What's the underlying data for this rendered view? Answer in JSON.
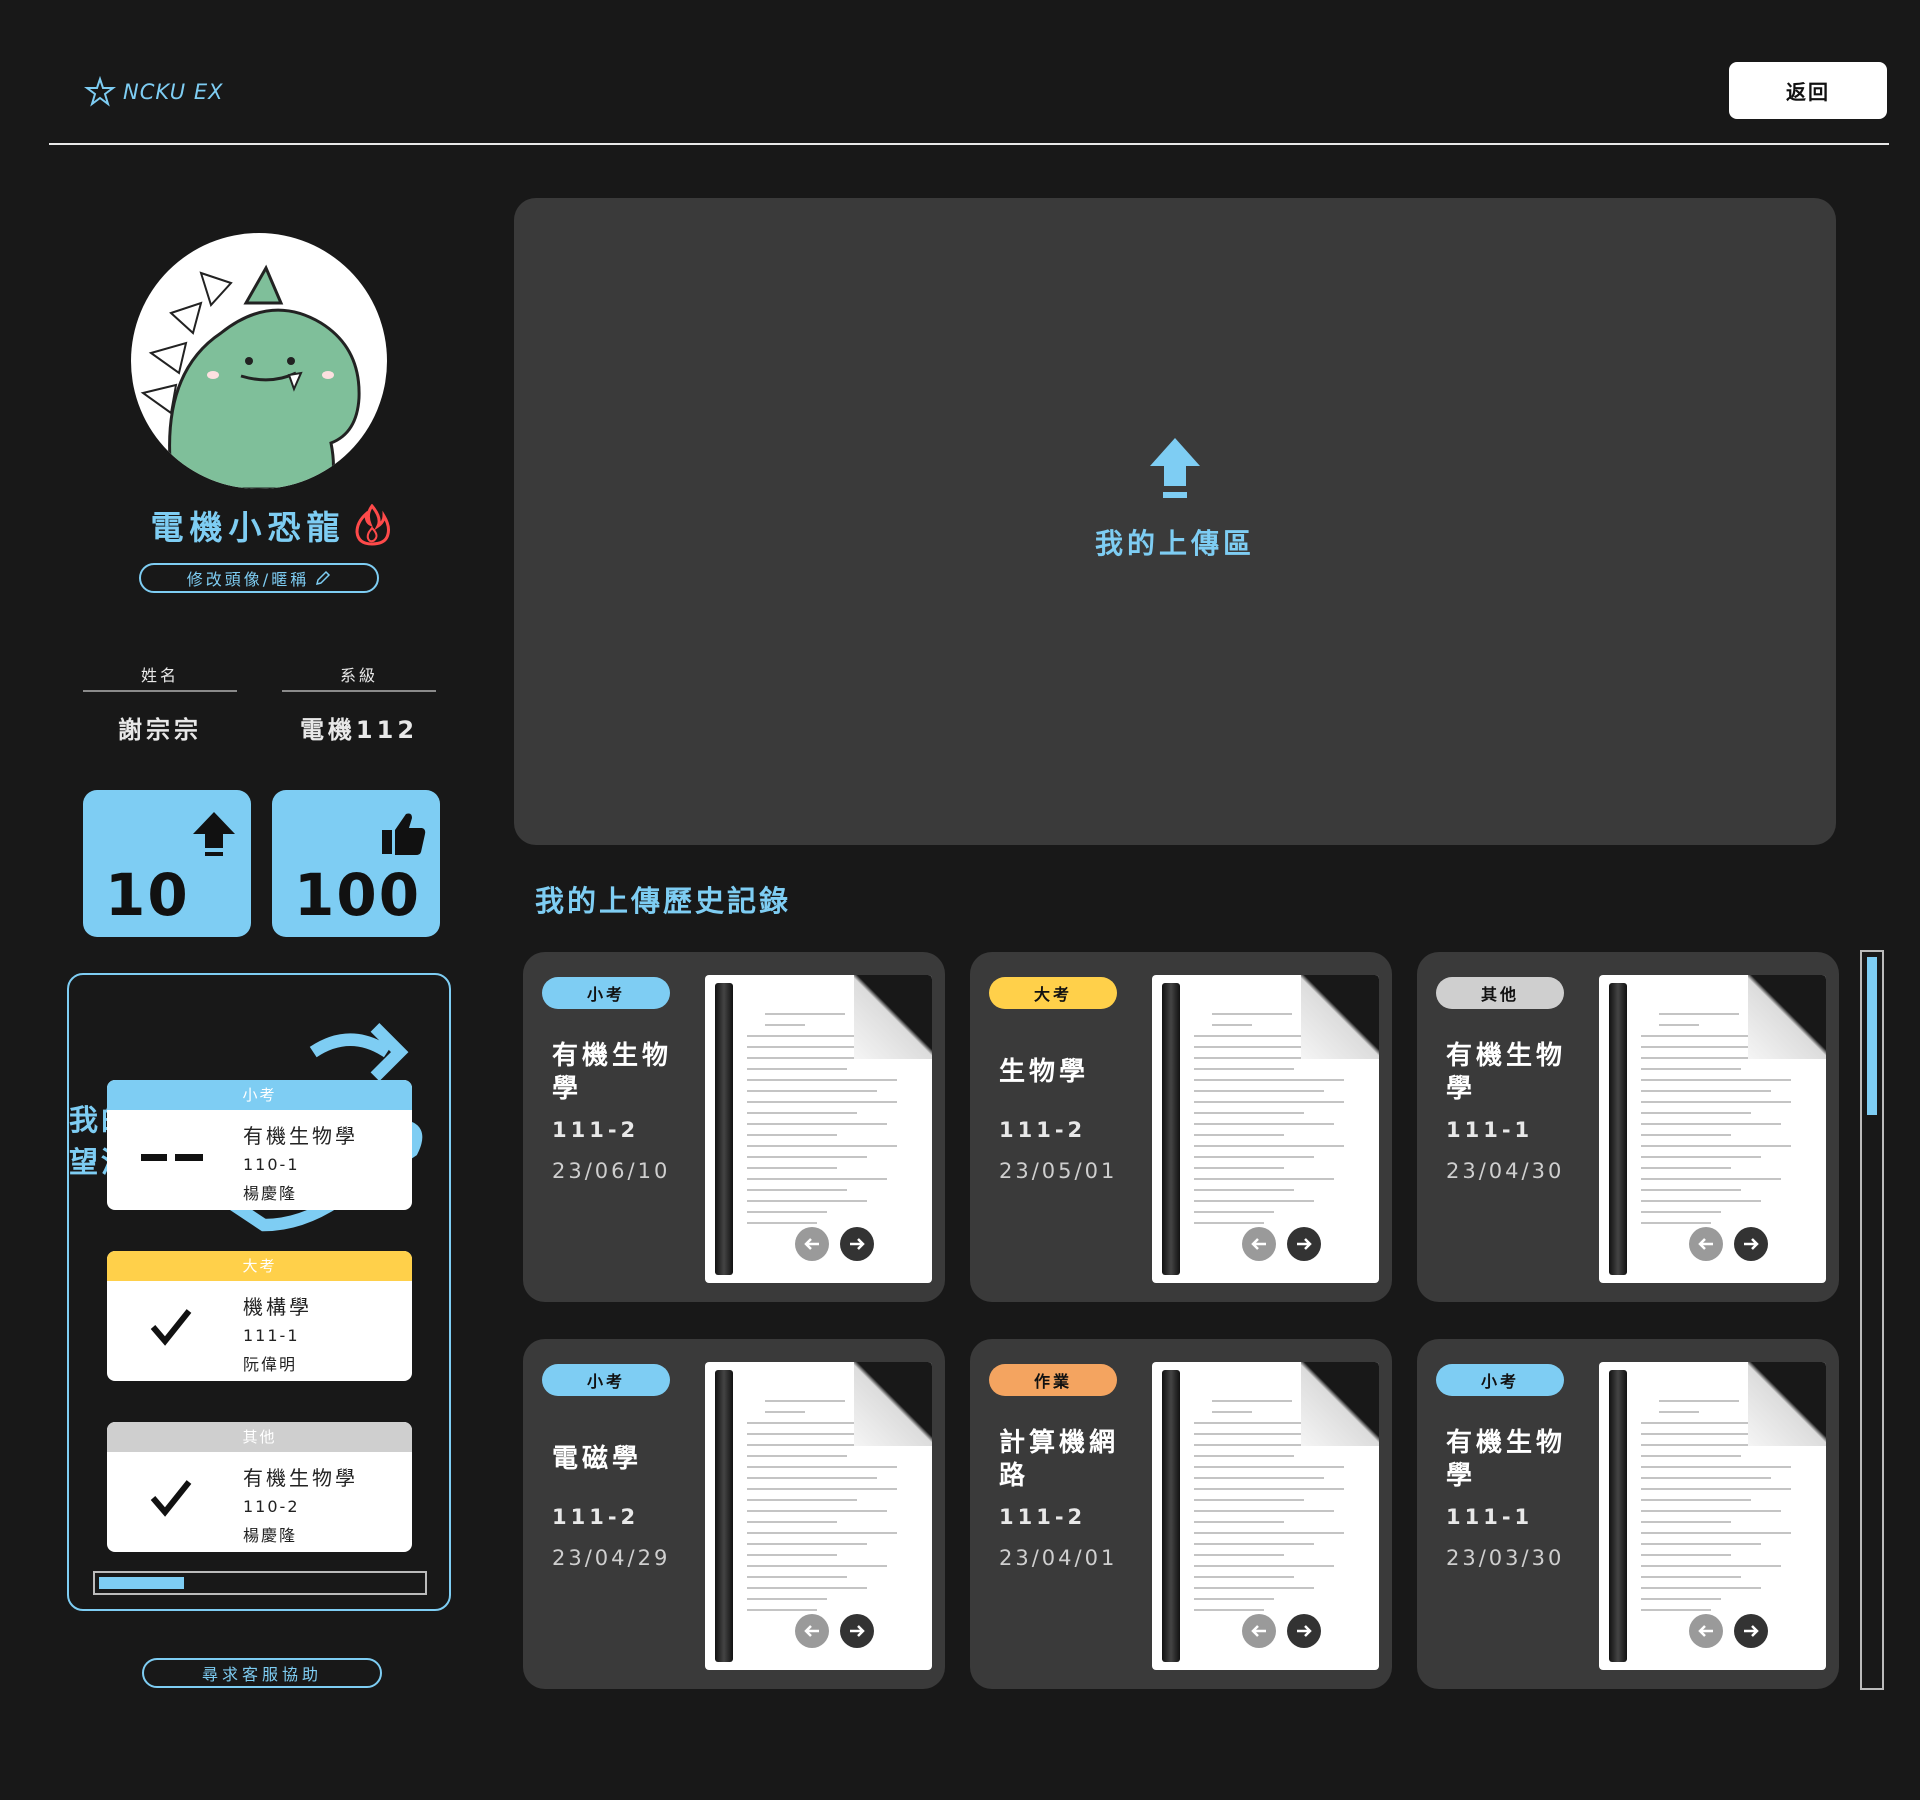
{
  "header": {
    "logo_text": "NCKU EX",
    "back_label": "返回"
  },
  "profile": {
    "nickname": "電機小恐龍",
    "edit_label": "修改頭像/暱稱",
    "name_label": "姓名",
    "name_value": "謝宗宗",
    "dept_label": "系級",
    "dept_value": "電機112",
    "uploads_count": "10",
    "likes_count": "100"
  },
  "wishlist": {
    "title": "我的願望清單",
    "items": [
      {
        "tag": "小考",
        "tag_color": "#7ecdf3",
        "status": "pending",
        "course": "有機生物學",
        "semester": "110-1",
        "teacher": "楊慶隆"
      },
      {
        "tag": "大考",
        "tag_color": "#ffd04a",
        "status": "done",
        "course": "機構學",
        "semester": "111-1",
        "teacher": "阮偉明"
      },
      {
        "tag": "其他",
        "tag_color": "#cfcfcf",
        "status": "done",
        "course": "有機生物學",
        "semester": "110-2",
        "teacher": "楊慶隆"
      }
    ],
    "scroll_fraction": 0.26
  },
  "support_label": "尋求客服協助",
  "upload": {
    "label": "我的上傳區"
  },
  "history": {
    "title": "我的上傳歷史記錄",
    "cards": [
      {
        "tag": "小考",
        "tag_color": "#7ecdf3",
        "course": "有機生物學",
        "semester": "111-2",
        "date": "23/06/10"
      },
      {
        "tag": "大考",
        "tag_color": "#ffd04a",
        "course": "生物學",
        "semester": "111-2",
        "date": "23/05/01"
      },
      {
        "tag": "其他",
        "tag_color": "#cfcfcf",
        "course": "有機生物學",
        "semester": "111-1",
        "date": "23/04/30"
      },
      {
        "tag": "小考",
        "tag_color": "#7ecdf3",
        "course": "電磁學",
        "semester": "111-2",
        "date": "23/04/29"
      },
      {
        "tag": "作業",
        "tag_color": "#f4a460",
        "course": "計算機網路",
        "semester": "111-2",
        "date": "23/04/01"
      },
      {
        "tag": "小考",
        "tag_color": "#7ecdf3",
        "course": "有機生物學",
        "semester": "111-1",
        "date": "23/03/30"
      }
    ]
  },
  "colors": {
    "accent": "#7ecdf3",
    "background": "#181818",
    "card": "#3a3a3a"
  }
}
